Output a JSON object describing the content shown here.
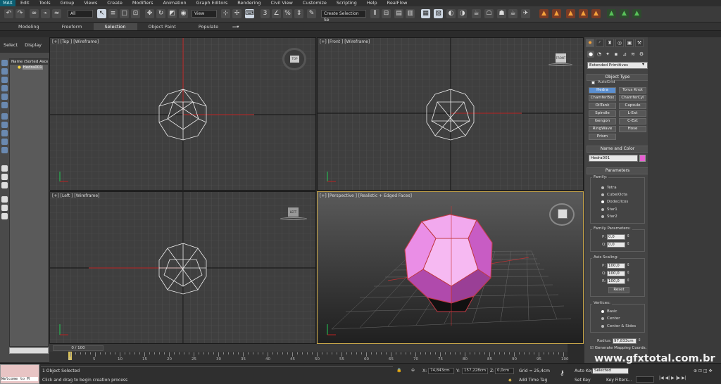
{
  "app_logo": "MAX",
  "menu": [
    "Edit",
    "Tools",
    "Group",
    "Views",
    "Create",
    "Modifiers",
    "Animation",
    "Graph Editors",
    "Rendering",
    "Civil View",
    "Customize",
    "Scripting",
    "Help",
    "RealFlow"
  ],
  "toolbar": {
    "filter_value": "All",
    "refcoord_value": "View",
    "named_selection": "Create Selection Se"
  },
  "ribbon_tabs": [
    "Modeling",
    "Freeform",
    "Selection",
    "Object Paint",
    "Populate"
  ],
  "ribbon_active": "Selection",
  "left_panel": {
    "tabs": [
      "Select",
      "Display"
    ],
    "header": "Name (Sorted Ascen",
    "items": [
      "Hedra001"
    ]
  },
  "viewports": {
    "top": "[+] [Top ] [Wireframe]",
    "front": "[+] [Front ] [Wireframe]",
    "left": "[+] [Left ] [Wireframe]",
    "persp": "[+] [Perspective ] [Realistic + Edged Faces]",
    "cube_top": "TOP",
    "cube_front": "FRONT",
    "cube_left": "LEFT"
  },
  "timeline": {
    "frame": "0 / 100",
    "ticks": [
      "0",
      "5",
      "10",
      "15",
      "20",
      "25",
      "30",
      "35",
      "40",
      "45",
      "50",
      "55",
      "60",
      "65",
      "70",
      "75",
      "80",
      "85",
      "90",
      "95",
      "100"
    ]
  },
  "status": {
    "welcome": "Welcome to M",
    "selected": "1 Object Selected",
    "prompt": "Click and drag to begin creation process",
    "x": "74,843cm",
    "y": "157,228cm",
    "z": "0,0cm",
    "grid": "Grid = 25,4cm",
    "add_time_tag": "Add Time Tag",
    "auto_key": "Auto Key",
    "set_key": "Set Key",
    "key_mode": "Selected",
    "key_filters": "Key Filters..."
  },
  "command_panel": {
    "category": "Extended Primitives",
    "object_type": "Object Type",
    "autogrid": "AutoGrid",
    "buttons": [
      "Hedra",
      "Torus Knot",
      "ChamferBox",
      "ChamferCyl",
      "OilTank",
      "Capsule",
      "Spindle",
      "L-Ext",
      "Gengon",
      "C-Ext",
      "RingWave",
      "Hose",
      "Prism"
    ],
    "active_button": "Hedra",
    "name_color": "Name and Color",
    "object_name": "Hedra001",
    "object_color": "#e85fd2",
    "parameters": "Parameters",
    "family_label": "Family:",
    "family": [
      "Tetra",
      "Cube/Octa",
      "Dodec/Icos",
      "Star1",
      "Star2"
    ],
    "family_selected": "Dodec/Icos",
    "family_params_label": "Family Parameters:",
    "p": "0,0",
    "q": "0,0",
    "axis_label": "Axis Scaling:",
    "ap": "100,0",
    "aq": "100,0",
    "ar": "100,0",
    "reset": "Reset",
    "vertices_label": "Vertices:",
    "vertices": [
      "Basic",
      "Center",
      "Center & Sides"
    ],
    "vertices_selected": "Basic",
    "radius_label": "Radius:",
    "radius": "97,833cm",
    "gen_mapping": "Generate Mapping Coords."
  },
  "watermark": "www.gfxtotal.com.br"
}
